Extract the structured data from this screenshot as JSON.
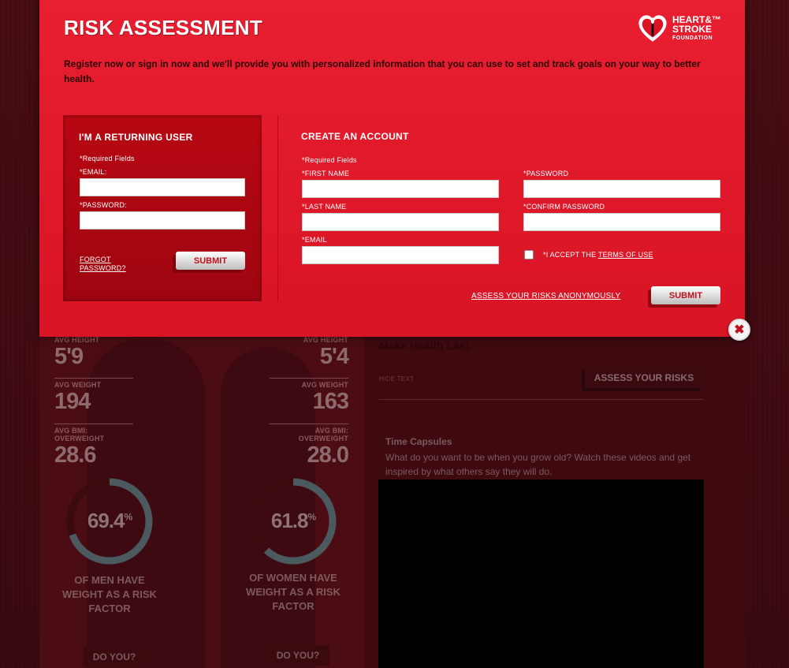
{
  "modal": {
    "title": "RISK ASSESSMENT",
    "intro": "Register now or sign in now and we'll provide you with personalized information that you can use to set and track goals on your way to better health.",
    "logo": {
      "line1": "HEART&™",
      "line2": "STROKE",
      "line3": "FOUNDATION",
      "icon": "heart-torch-logo"
    },
    "returning": {
      "title": "I'M A RETURNING USER",
      "required": "*Required Fields",
      "email_label": "*EMAIL:",
      "password_label": "*PASSWORD:",
      "forgot_line1": "FORGOT",
      "forgot_line2": "PASSWORD?",
      "submit": "SUBMIT"
    },
    "create": {
      "title": "CREATE AN ACCOUNT",
      "required": "*Required Fields",
      "first_name_label": "*FIRST NAME",
      "last_name_label": "*LAST NAME",
      "email_label": "*EMAIL",
      "password_label": "*PASSWORD",
      "confirm_label": "*CONFIRM PASSWORD",
      "accept_prefix": "*I ACCEPT THE ",
      "terms": "TERMS OF USE",
      "anon_link": "ASSESS YOUR RISKS ANONYMOUSLY",
      "submit": "SUBMIT"
    },
    "close_icon": "close-icon"
  },
  "background": {
    "men": {
      "height_label": "AVG HEIGHT",
      "height": "5'9",
      "weight_label": "AVG WEIGHT",
      "weight": "194",
      "bmi_label1": "AVG BMI:",
      "bmi_label2": "OVERWEIGHT",
      "bmi": "28.6",
      "percent": "69.4",
      "percent_fraction": 0.694,
      "caption1": "OF MEN HAVE",
      "caption2": "WEIGHT AS A RISK",
      "caption3": "FACTOR",
      "do_you": "DO YOU?"
    },
    "women": {
      "height_label": "AVG HEIGHT",
      "height": "5'4",
      "weight_label": "AVG WEIGHT",
      "weight": "163",
      "bmi_label1": "AVG BMI:",
      "bmi_label2": "OVERWEIGHT",
      "bmi": "28.0",
      "percent": "61.8",
      "percent_fraction": 0.618,
      "caption1": "OF WOMEN HAVE",
      "caption2": "WEIGHT AS A RISK",
      "caption3": "FACTOR",
      "do_you": "DO YOU?"
    },
    "percent_sign": "%",
    "right": {
      "headline": "Make Health Last.",
      "hide_text": "HIDE TEXT",
      "assess_button": "ASSESS YOUR RISKS",
      "capsule_title": "Time Capsules",
      "capsule_text": "What do you want to be when you grow old? Watch these videos and get inspired by what others say they will do."
    }
  }
}
